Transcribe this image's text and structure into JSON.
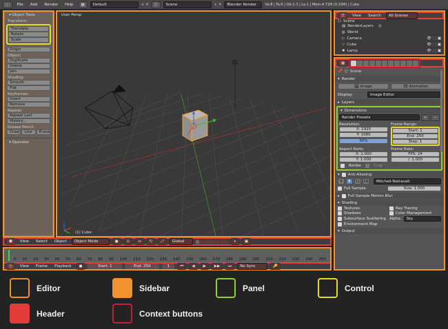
{
  "topbar": {
    "menus": [
      "File",
      "Add",
      "Render",
      "Help"
    ],
    "layout": "Default",
    "scene": "Scene",
    "engine": "Blender Render",
    "stats": "Ve:8 | Fa:6 | Ob:1-3 | La:1 | Mem:4.71M (0.10M) | Cube"
  },
  "toolshelf": {
    "title": "Object Tools",
    "sections": [
      {
        "label": "Transform:",
        "buttons": [
          "Translate",
          "Rotate",
          "Scale"
        ]
      },
      {
        "label": "",
        "buttons": [
          "Origin"
        ]
      },
      {
        "label": "Object:",
        "buttons": [
          "Duplicate",
          "Delete",
          "Join"
        ]
      },
      {
        "label": "Shading:",
        "buttons": [
          "Smooth",
          "Flat"
        ]
      },
      {
        "label": "Keyframes:",
        "buttons": [
          "Insert",
          "Remove"
        ]
      },
      {
        "label": "Repeat:",
        "buttons": [
          "Repeat Last",
          "History..."
        ]
      }
    ],
    "grease_label": "Grease Pencil:",
    "grease_buttons": [
      "Draw",
      "Line",
      "Erase"
    ],
    "operator": "Operator"
  },
  "viewport": {
    "view_label": "User Persp",
    "object_label": "(1) Cube"
  },
  "vp_header": {
    "menus": [
      "View",
      "Select",
      "Object"
    ],
    "mode": "Object Mode",
    "orientation": "Global"
  },
  "timeline": {
    "ticks": [
      "0",
      "10",
      "20",
      "30",
      "40",
      "50",
      "60",
      "70",
      "80",
      "90",
      "100",
      "110",
      "120",
      "130",
      "140",
      "150",
      "160",
      "170",
      "180",
      "190",
      "200",
      "210",
      "220",
      "230",
      "240",
      "250"
    ],
    "menus": [
      "View",
      "Frame",
      "Playback"
    ],
    "start": "Start: 1",
    "end": "End: 250",
    "current": "1",
    "sync": "No Sync"
  },
  "outliner": {
    "header_menus": [
      "View",
      "Search"
    ],
    "filter": "All Scenes",
    "rows": [
      "Scene",
      "RenderLayers",
      "World",
      "Camera",
      "Cube",
      "Lamp"
    ]
  },
  "properties": {
    "breadcrumb": "Scene",
    "render": {
      "title": "Render",
      "image_btn": "Image",
      "anim_btn": "Animation",
      "display_label": "Display:",
      "display_value": "Image Editor"
    },
    "layers_title": "Layers",
    "dimensions": {
      "title": "Dimensions",
      "presets": "Render Presets",
      "res_label": "Resolution:",
      "res_x": "X: 1920",
      "res_y": "Y: 1080",
      "res_pct": "50%",
      "frame_label": "Frame Range:",
      "start": "Start: 1",
      "end": "End: 250",
      "step": "Step: 1",
      "aspect_label": "Aspect Ratio:",
      "aspect_x": "X: 1.000",
      "aspect_y": "Y: 1.000",
      "fr_label": "Frame Rate:",
      "fps": "FPS: 24",
      "fps_base": "/: 1.000",
      "border": "Border",
      "crop": "Crop"
    },
    "aa": {
      "title": "Anti-Aliasing",
      "samples": [
        "5",
        "8",
        "11",
        "16"
      ],
      "filter": "Mitchell-Netravali",
      "full_sample": "Full Sample",
      "size": "Size: 1.000"
    },
    "motion_blur": "Full Sample Motion Blur",
    "shading": {
      "title": "Shading",
      "textures": "Textures",
      "ray": "Ray Tracing",
      "shadows": "Shadows",
      "color_mgmt": "Color Management",
      "sss": "Subsurface Scattering",
      "alpha_label": "Alpha:",
      "alpha_value": "Sky",
      "env": "Environment Map"
    },
    "output": "Output"
  },
  "legend": [
    {
      "label": "Editor",
      "kind": "outline",
      "color": "#f0932f"
    },
    {
      "label": "Sidebar",
      "kind": "fill",
      "color": "#f0932f"
    },
    {
      "label": "Panel",
      "kind": "outline",
      "color": "#8fd331"
    },
    {
      "label": "Control",
      "kind": "outline",
      "color": "#e8dc2a"
    },
    {
      "label": "Header",
      "kind": "fill",
      "color": "#e53a3a"
    },
    {
      "label": "Context buttons",
      "kind": "outline",
      "color": "#c0203a"
    }
  ],
  "colors": {
    "editor": "#f0932f",
    "panel": "#8fd331",
    "control": "#e8dc2a",
    "header": "#e53a3a",
    "context": "#c0203a"
  }
}
